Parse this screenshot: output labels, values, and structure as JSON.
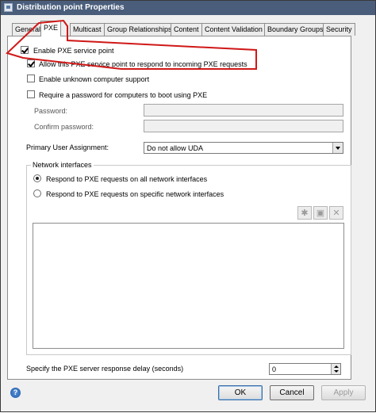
{
  "window": {
    "title": "Distribution point Properties"
  },
  "tabs": [
    {
      "label": "General"
    },
    {
      "label": "PXE"
    },
    {
      "label": "Multicast"
    },
    {
      "label": "Group Relationships"
    },
    {
      "label": "Content"
    },
    {
      "label": "Content Validation"
    },
    {
      "label": "Boundary Groups"
    },
    {
      "label": "Security"
    }
  ],
  "pxe": {
    "enable_label": "Enable PXE service point",
    "enable_checked": true,
    "allow_label": "Allow this PXE service point to respond to incoming PXE requests",
    "allow_checked": true,
    "unknown_label": "Enable unknown computer support",
    "unknown_checked": false,
    "require_pw_label": "Require a password for computers to boot using PXE",
    "require_pw_checked": false,
    "password_label": "Password:",
    "confirm_label": "Confirm password:",
    "uda_label": "Primary User Assignment:",
    "uda_value": "Do not allow UDA",
    "net_group_label": "Network interfaces",
    "radio_all_label": "Respond to PXE requests on all network interfaces",
    "radio_specific_label": "Respond to PXE requests on specific network interfaces",
    "delay_label": "Specify the PXE server response delay (seconds)",
    "delay_value": "0"
  },
  "buttons": {
    "ok": "OK",
    "cancel": "Cancel",
    "apply": "Apply",
    "help": "?"
  },
  "colors": {
    "annotation_red": "#d01818",
    "title_bar": "#4a5e7c"
  }
}
